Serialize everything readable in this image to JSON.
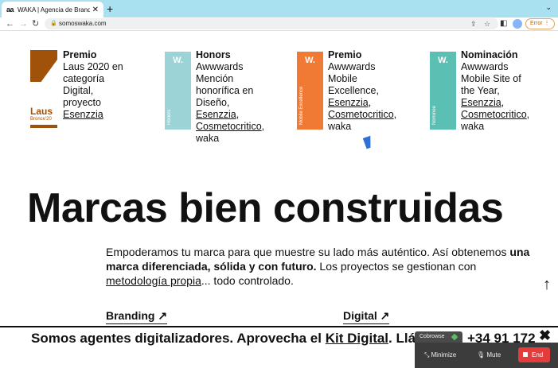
{
  "browser": {
    "tab_favicon": "aa",
    "tab_title": "WAKA | Agencia de Branding y",
    "tab_close": "✕",
    "new_tab": "+",
    "tab_menu": "⌄",
    "back": "←",
    "forward": "→",
    "reload": "↻",
    "url": "somoswaka.com",
    "error_label": "Error"
  },
  "awards": [
    {
      "badge_text": "Laus",
      "badge_sub": "Bronce'20",
      "title": "Premio",
      "lines": [
        "Laus 2020 en",
        "categoría",
        "Digital,",
        "proyecto"
      ],
      "link": "Esenzzia",
      "tail": []
    },
    {
      "badge_w": "W.",
      "badge_vertical": "Honors",
      "title": "Honors",
      "lines": [
        "Awwwards",
        "Mención",
        "honorífica en",
        "Diseño,"
      ],
      "link": "Esenzzia",
      "link2": "Cosmetocritico",
      "tail": [
        "waka"
      ]
    },
    {
      "badge_w": "W.",
      "badge_vertical": "Mobile Excellence",
      "title": "Premio",
      "lines": [
        "Awwwards",
        "Mobile",
        "Excellence,"
      ],
      "link": "Esenzzia",
      "link2": "Cosmetocritico",
      "tail": [
        "waka"
      ]
    },
    {
      "badge_w": "W.",
      "badge_vertical": "Nominee",
      "title": "Nominación",
      "lines": [
        "Awwwards",
        "Mobile Site of",
        "the Year,"
      ],
      "link": "Esenzzia",
      "link2": "Cosmetocritico",
      "tail": [
        "waka"
      ]
    }
  ],
  "hero": {
    "title": "Marcas bien construidas"
  },
  "intro": {
    "part1": "Empoderamos tu marca para que muestre su lado más auténtico. Así obtenemos ",
    "bold": "una marca diferenciada, sólida y con futuro.",
    "part2": " Los proyectos se gestionan con ",
    "link": "metodología propia",
    "part3": "... todo controlado."
  },
  "services": {
    "branding": "Branding ↗",
    "digital": "Digital ↗"
  },
  "scroll_top": "↑",
  "banner": {
    "text1": "Somos agentes digitalizadores. Aprovecha el ",
    "link": "Kit Digital",
    "text2": ". Llám",
    "phone": "+34 91 172",
    "close": "✖"
  },
  "cobrowse": {
    "label": "Cobrowse",
    "minimize": "Minimize",
    "mute": "Mute",
    "end": "End"
  },
  "colors": {
    "laus": "#a0520a",
    "honors": "#9bd3d6",
    "mobile": "#f07a34",
    "nominee": "#5bbfb4",
    "end": "#e23c3c"
  }
}
